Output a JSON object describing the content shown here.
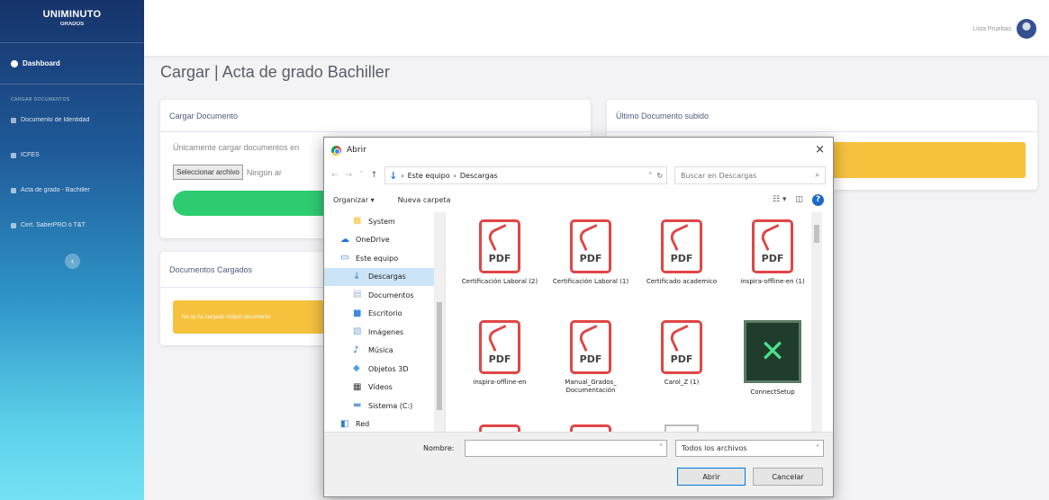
{
  "brand": {
    "name": "UNIMINUTO",
    "sub": "GRADOS"
  },
  "sidebar": {
    "dashboard": "Dashboard",
    "section": "CARGAR DOCUMENTOS",
    "items": [
      {
        "label": "Documento de Identidad"
      },
      {
        "label": "ICFES"
      },
      {
        "label": "Acta de grado - Bachiller"
      },
      {
        "label": "Cert. SaberPRO ó T&T"
      }
    ],
    "collapse": "‹"
  },
  "topbar": {
    "user": "Lista Pruebas"
  },
  "page": {
    "title": "Cargar | Acta de grado Bachiller"
  },
  "upload_card": {
    "header": "Cargar Documento",
    "hint": "Únicamente cargar documentos en",
    "file_button": "Seleccionar archivo",
    "file_none": "Ningún ar"
  },
  "last_card": {
    "header": "Último Documento subido"
  },
  "uploaded_card": {
    "header": "Documentos Cargados",
    "alert": "No se ha cargado ningún documento"
  },
  "dialog": {
    "title": "Abrir",
    "close": "×",
    "path": [
      "Este equipo",
      "Descargas"
    ],
    "search_placeholder": "Buscar en Descargas",
    "organize": "Organizar ▾",
    "new_folder": "Nueva carpeta",
    "nav": [
      {
        "label": "System",
        "icon": "folder-icon",
        "color": "#f7d774"
      },
      {
        "label": "OneDrive",
        "icon": "cloud-icon",
        "color": "#1a73d9"
      },
      {
        "label": "Este equipo",
        "icon": "computer-icon",
        "color": "#2a7fd4"
      },
      {
        "label": "Descargas",
        "icon": "download-icon",
        "color": "#2a7fd4",
        "selected": true
      },
      {
        "label": "Documentos",
        "icon": "document-icon",
        "color": "#9bb6d8"
      },
      {
        "label": "Escritorio",
        "icon": "desktop-icon",
        "color": "#3e8be0"
      },
      {
        "label": "Imágenes",
        "icon": "image-icon",
        "color": "#7fa7d6"
      },
      {
        "label": "Música",
        "icon": "music-icon",
        "color": "#1d5fb8"
      },
      {
        "label": "Objetos 3D",
        "icon": "cube-icon",
        "color": "#4aa0e6"
      },
      {
        "label": "Vídeos",
        "icon": "video-icon",
        "color": "#3a3a3a"
      },
      {
        "label": "Sistema (C:)",
        "icon": "drive-icon",
        "color": "#6f9fcf"
      },
      {
        "label": "Red",
        "icon": "network-icon",
        "color": "#2a7fd4"
      }
    ],
    "files": [
      {
        "name": "Certificación Laboral (2)",
        "type": "pdf"
      },
      {
        "name": "Certificación Laboral (1)",
        "type": "pdf"
      },
      {
        "name": "Certificado academico",
        "type": "pdf"
      },
      {
        "name": "inspira-offline-en (1)",
        "type": "pdf"
      },
      {
        "name": "inspira-offline-en",
        "type": "pdf"
      },
      {
        "name": "Manual_Grados_ Documentación",
        "type": "pdf"
      },
      {
        "name": "Carol_Z (1)",
        "type": "pdf"
      },
      {
        "name": "ConnectSetup",
        "type": "app"
      }
    ],
    "pdf_label": "PDF",
    "filename_label": "Nombre:",
    "filename_value": "",
    "filter": "Todos los archivos",
    "open_button": "Abrir",
    "cancel_button": "Cancelar"
  }
}
